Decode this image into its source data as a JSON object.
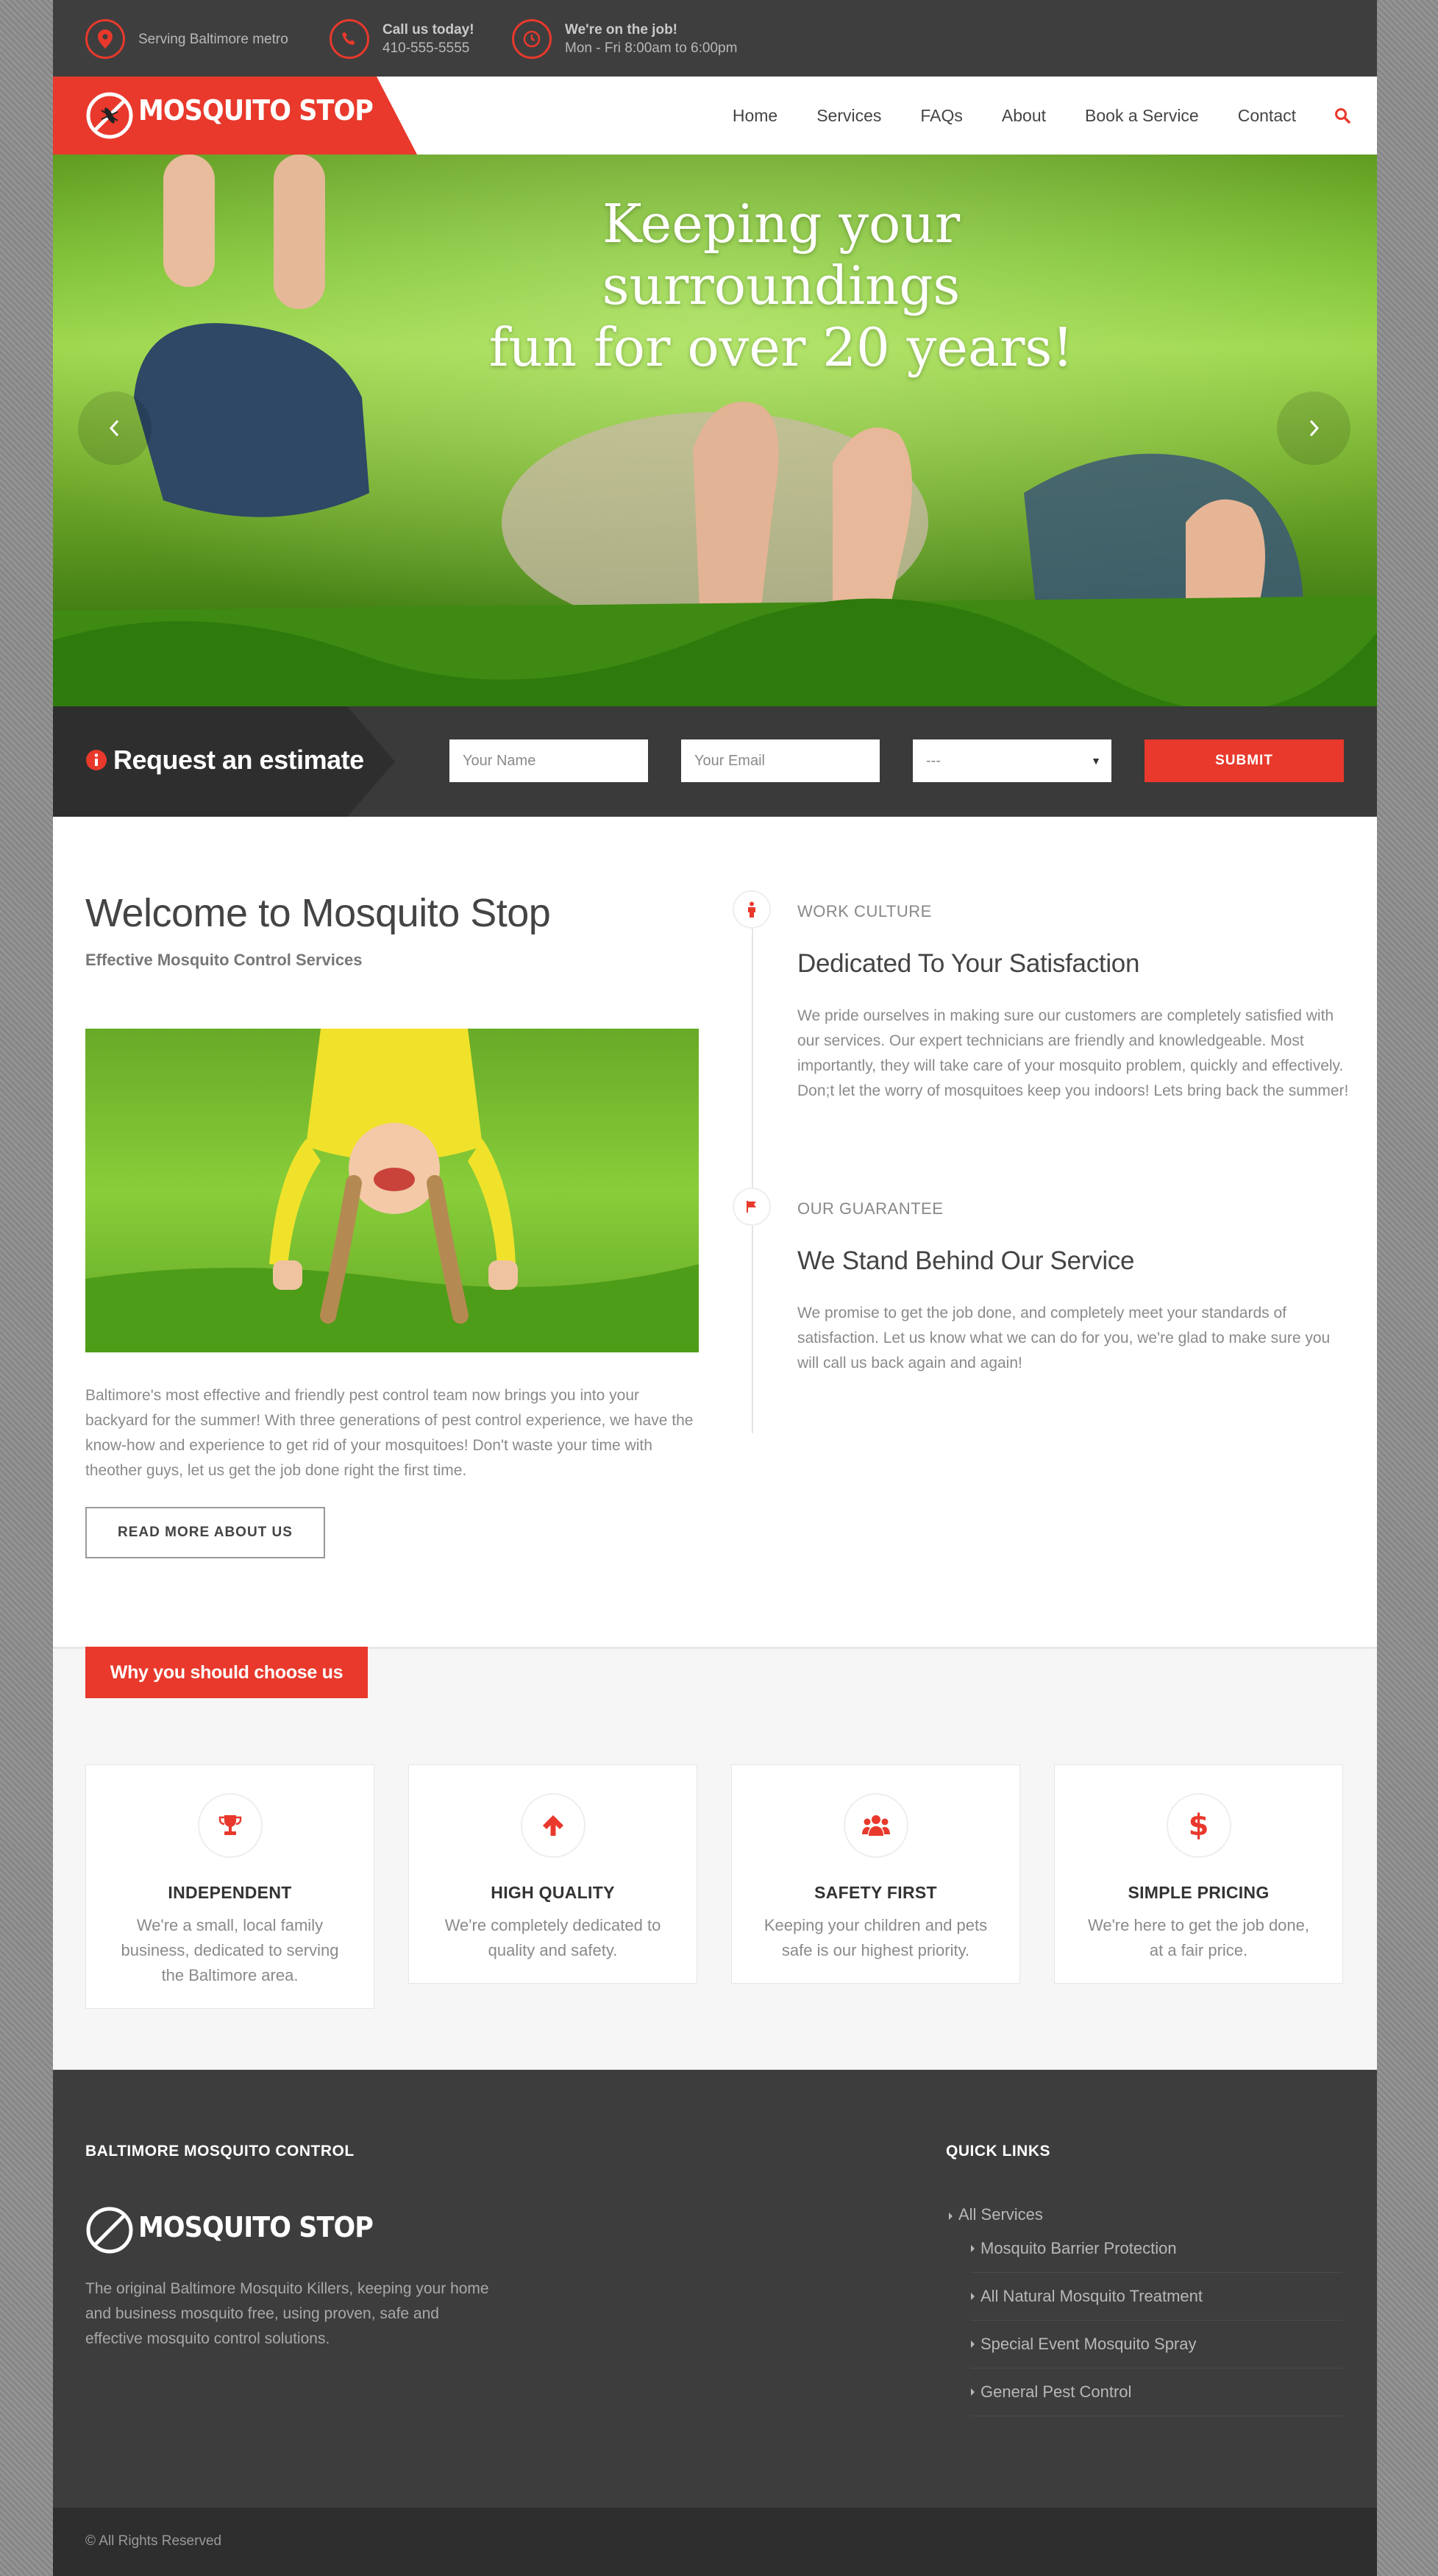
{
  "topbar": {
    "location": "Serving Baltimore metro",
    "call_title": "Call us today!",
    "call_phone": "410-555-5555",
    "hours_title": "We're on the job!",
    "hours_text": "Mon - Fri 8:00am to 6:00pm"
  },
  "brand": {
    "name": "MOSQUITO STOP",
    "accent_color": "#e8392c"
  },
  "nav": {
    "items": [
      "Home",
      "Services",
      "FAQs",
      "About",
      "Book a Service",
      "Contact"
    ],
    "search_icon": "search-icon"
  },
  "hero": {
    "title_line1": "Keeping your surroundings",
    "title_line2": "fun for over 20 years!"
  },
  "estimate": {
    "label": "Request an estimate",
    "name_placeholder": "Your Name",
    "email_placeholder": "Your Email",
    "select_value": "---",
    "submit": "SUBMIT"
  },
  "welcome": {
    "title": "Welcome to Mosquito Stop",
    "subtitle": "Effective Mosquito Control Services",
    "body": "Baltimore's most effective and friendly pest control team now brings you into your backyard for the summer! With three generations of pest control experience, we have the know-how and  experience to get rid of your mosquitoes! Don't waste your time with theother guys, let us get the job done right the first time.",
    "button": "READ MORE ABOUT US"
  },
  "timeline": [
    {
      "category": "WORK CULTURE",
      "heading": "Dedicated To Your Satisfaction",
      "body": "We pride ourselves in making sure our customers are completely satisfied with our services. Our expert technicians are friendly and knowledgeable. Most importantly, they will take care of your mosquito problem, quickly and effectively. Don;t let the worry of mosquitoes keep you indoors! Lets  bring back the summer!",
      "icon": "person-icon"
    },
    {
      "category": "OUR GUARANTEE",
      "heading": "We Stand Behind Our Service",
      "body": "We promise to get the job done, and completely meet your standards of satisfaction. Let us know what we can do for you, we're glad to make sure you will call us back again and again!",
      "icon": "flag-icon"
    }
  ],
  "choose": {
    "tab": "Why you should choose us",
    "features": [
      {
        "title": "INDEPENDENT",
        "desc": "We're a small, local family business, dedicated to serving the Baltimore area.",
        "icon": "trophy-icon"
      },
      {
        "title": "HIGH QUALITY",
        "desc": "We're completely dedicated to quality and safety.",
        "icon": "arrow-up-icon"
      },
      {
        "title": "SAFETY FIRST",
        "desc": "Keeping your children and pets safe is our highest priority.",
        "icon": "group-icon"
      },
      {
        "title": "SIMPLE PRICING",
        "desc": "We're here to get the job done, at a fair price.",
        "icon": "dollar-icon"
      }
    ]
  },
  "footer": {
    "col1_title": "BALTIMORE MOSQUITO CONTROL",
    "about": "The original Baltimore Mosquito Killers, keeping your home and business mosquito free, using proven, safe and effective mosquito control solutions.",
    "col2_title": "QUICK LINKS",
    "links_parent": "All Services",
    "links": [
      "Mosquito Barrier Protection",
      "All Natural Mosquito Treatment",
      "Special Event Mosquito Spray",
      "General Pest Control"
    ],
    "copyright": "© All Rights Reserved"
  }
}
